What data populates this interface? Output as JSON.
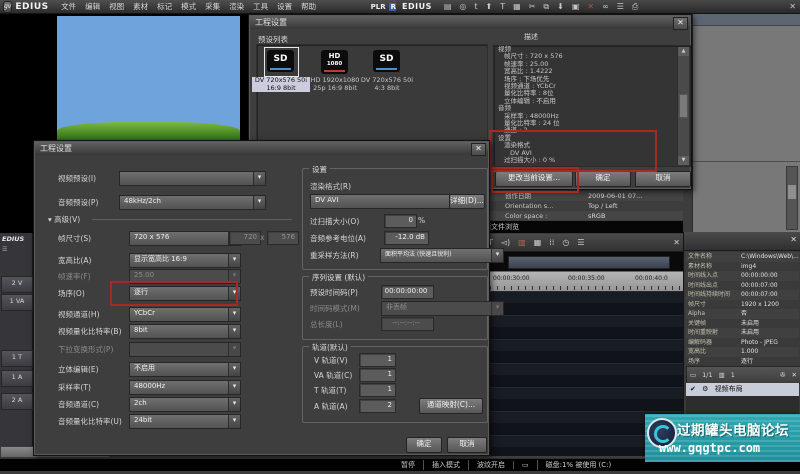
{
  "icons": {
    "close": "✕",
    "min": "–",
    "folder": "▤",
    "search": "◎",
    "lowt": "t",
    "export": "⬆",
    "text": "T",
    "monitor": "▦",
    "cut": "✂",
    "copy": "⧉",
    "down": "⬇",
    "image": "▣",
    "marker": "◮",
    "redx": "✕",
    "loop": "∞",
    "list": "☰",
    "print": "⎙",
    "up_arrow": "▲",
    "down_arrow": "▼",
    "adv_arrow": "▾",
    "speaker": "◅)",
    "film": "▥",
    "grid": "▦",
    "mixer": "⁞⁞",
    "clock": "◷",
    "menu": "☰",
    "check": "✔",
    "gear": "⚙",
    "reel": "✇",
    "pager": "▭",
    "win": "▭",
    "logo": "gv"
  },
  "menubar": {
    "logo": "EDIUS",
    "items": [
      "文件",
      "编辑",
      "视图",
      "素材",
      "标记",
      "模式",
      "采集",
      "渲染",
      "工具",
      "设置",
      "帮助"
    ],
    "plr": "PLR",
    "rec": "REC"
  },
  "bin_window": {
    "title": "EDIUS"
  },
  "dialog1": {
    "title": "工程设置",
    "preset_list_label": "预设列表",
    "desc_label": "描述",
    "presets": [
      {
        "badge": "SD",
        "line1": "DV 720x576 50i",
        "line2": "16:9 8bit",
        "bar": "#4a8fd0"
      },
      {
        "badge": "HD",
        "badge2": "1080",
        "line1": "HD 1920x1080",
        "line2": "25p 16:9 8bit",
        "bar": "#c23a2e"
      },
      {
        "badge": "SD",
        "line1": "DV 720x576 50i",
        "line2": "4:3 8bit",
        "bar": "#4a8fd0"
      }
    ],
    "desc_lines": [
      "视频",
      "帧尺寸 : 720 x 576",
      "帧速率 : 25.00",
      "宽高比 : 1.4222",
      "场序 : 下场优先",
      "视频通道 : YCbCr",
      "量化比特率 : 8位",
      "立体编辑 : 不启用",
      "音频",
      "采样率 : 48000Hz",
      "量化比特率 : 24 位",
      "通道 : 2",
      "设置",
      "渲染格式",
      "DV AVI",
      "过扫描大小 : 0 %"
    ],
    "change_btn": "更改当前设置...",
    "ok": "确定",
    "cancel": "取消"
  },
  "meta_rows": [
    {
      "k": "创作日期",
      "v": "2009-06-01 07..."
    },
    {
      "k": "Orientation s...",
      "v": "Top / Left"
    },
    {
      "k": "Color space :",
      "v": "sRGB"
    }
  ],
  "source_bar": "源文件浏览",
  "timeline": {
    "edius": "EDIUS",
    "ruler": [
      "00:00:30:00",
      "00:00:35:00",
      "00:00:40:0"
    ],
    "tracks": [
      "2 V",
      "1 VA",
      "1 T",
      "1 A",
      "2 A"
    ]
  },
  "dialog2": {
    "title": "工程设置",
    "video_preset_label": "视频预设(I)",
    "video_preset_value": "",
    "audio_preset_label": "音频预设(P)",
    "audio_preset_value": "48kHz/2ch",
    "advanced": "高级(V)",
    "rows": [
      {
        "label": "帧尺寸(S)",
        "value": "720 x 576"
      },
      {
        "label": "宽高比(A)",
        "value": "显示宽高比 16:9"
      },
      {
        "label": "帧速率(F)",
        "value": "25.00"
      },
      {
        "label": "场序(O)",
        "value": "逐行"
      },
      {
        "label": "视频通道(H)",
        "value": "YCbCr"
      },
      {
        "label": "视频量化比特率(B)",
        "value": "8bit"
      },
      {
        "label": "下拉变换形式(P)",
        "value": ""
      },
      {
        "label": "立体编辑(E)",
        "value": "不启用"
      },
      {
        "label": "采样率(T)",
        "value": "48000Hz"
      },
      {
        "label": "音频通道(C)",
        "value": "2ch"
      },
      {
        "label": "音频量化比特率(U)",
        "value": "24bit"
      }
    ],
    "frame_w": "720",
    "x_sep": "x",
    "frame_h": "576",
    "settings_group": {
      "title": "设置",
      "render_label": "渲染格式(R)",
      "render_value": "DV AVI",
      "detail_btn": "详细(D)...",
      "overscan_label": "过扫描大小(O)",
      "overscan_value": "0",
      "overscan_unit": "%",
      "audio_ref_label": "音频参考电位(A)",
      "audio_ref_value": "-12.0 dB",
      "resample_label": "重采样方法(R)",
      "resample_value": "面积平均法 (快速且锐利)"
    },
    "sequence_group": {
      "title": "序列设置 (默认)",
      "tc_label": "预设时间码(P)",
      "tc_value": "00:00:00:00",
      "tcmode_label": "时间码模式(M)",
      "tcmode_value": "非丢帧",
      "length_label": "总长度(L)",
      "length_value": "--:--:--:--"
    },
    "track_group": {
      "title": "轨道(默认)",
      "rows": [
        {
          "label": "V 轨道(V)",
          "value": "1"
        },
        {
          "label": "VA 轨道(C)",
          "value": "1"
        },
        {
          "label": "T 轨道(T)",
          "value": "1"
        },
        {
          "label": "A 轨道(A)",
          "value": "2"
        }
      ],
      "chmap_btn": "通道映射(C)..."
    },
    "ok": "确定",
    "cancel": "取消"
  },
  "props_panel": {
    "rows": [
      {
        "k": "文件名称",
        "v": "C:\\Windows\\Web\\..."
      },
      {
        "k": "素材名称",
        "v": "img4"
      },
      {
        "k": "时间线入点",
        "v": "00:00:00:00"
      },
      {
        "k": "时间线出点",
        "v": "00:00:07:00"
      },
      {
        "k": "时间线持续时间",
        "v": "00:00:07:00"
      },
      {
        "k": "帧尺寸",
        "v": "1920 x 1200"
      },
      {
        "k": "Alpha",
        "v": "否"
      },
      {
        "k": "关键帧",
        "v": "未启用"
      },
      {
        "k": "时间重映射",
        "v": "未启用"
      },
      {
        "k": "编解码器",
        "v": "Photo - JPEG"
      },
      {
        "k": "宽高比",
        "v": "1.000"
      },
      {
        "k": "场序",
        "v": "逐行"
      }
    ]
  },
  "effects_panel": {
    "pager": "1/1",
    "count": "1",
    "row_label": "视频布局"
  },
  "watermark": {
    "line1": "过期罐头电脑论坛",
    "line2": "www.gqgtpc.com"
  },
  "statusbar": {
    "items": [
      "暂停",
      "插入模式",
      "波纹开启",
      "磁盘:1% 被使用 (C:)"
    ]
  }
}
